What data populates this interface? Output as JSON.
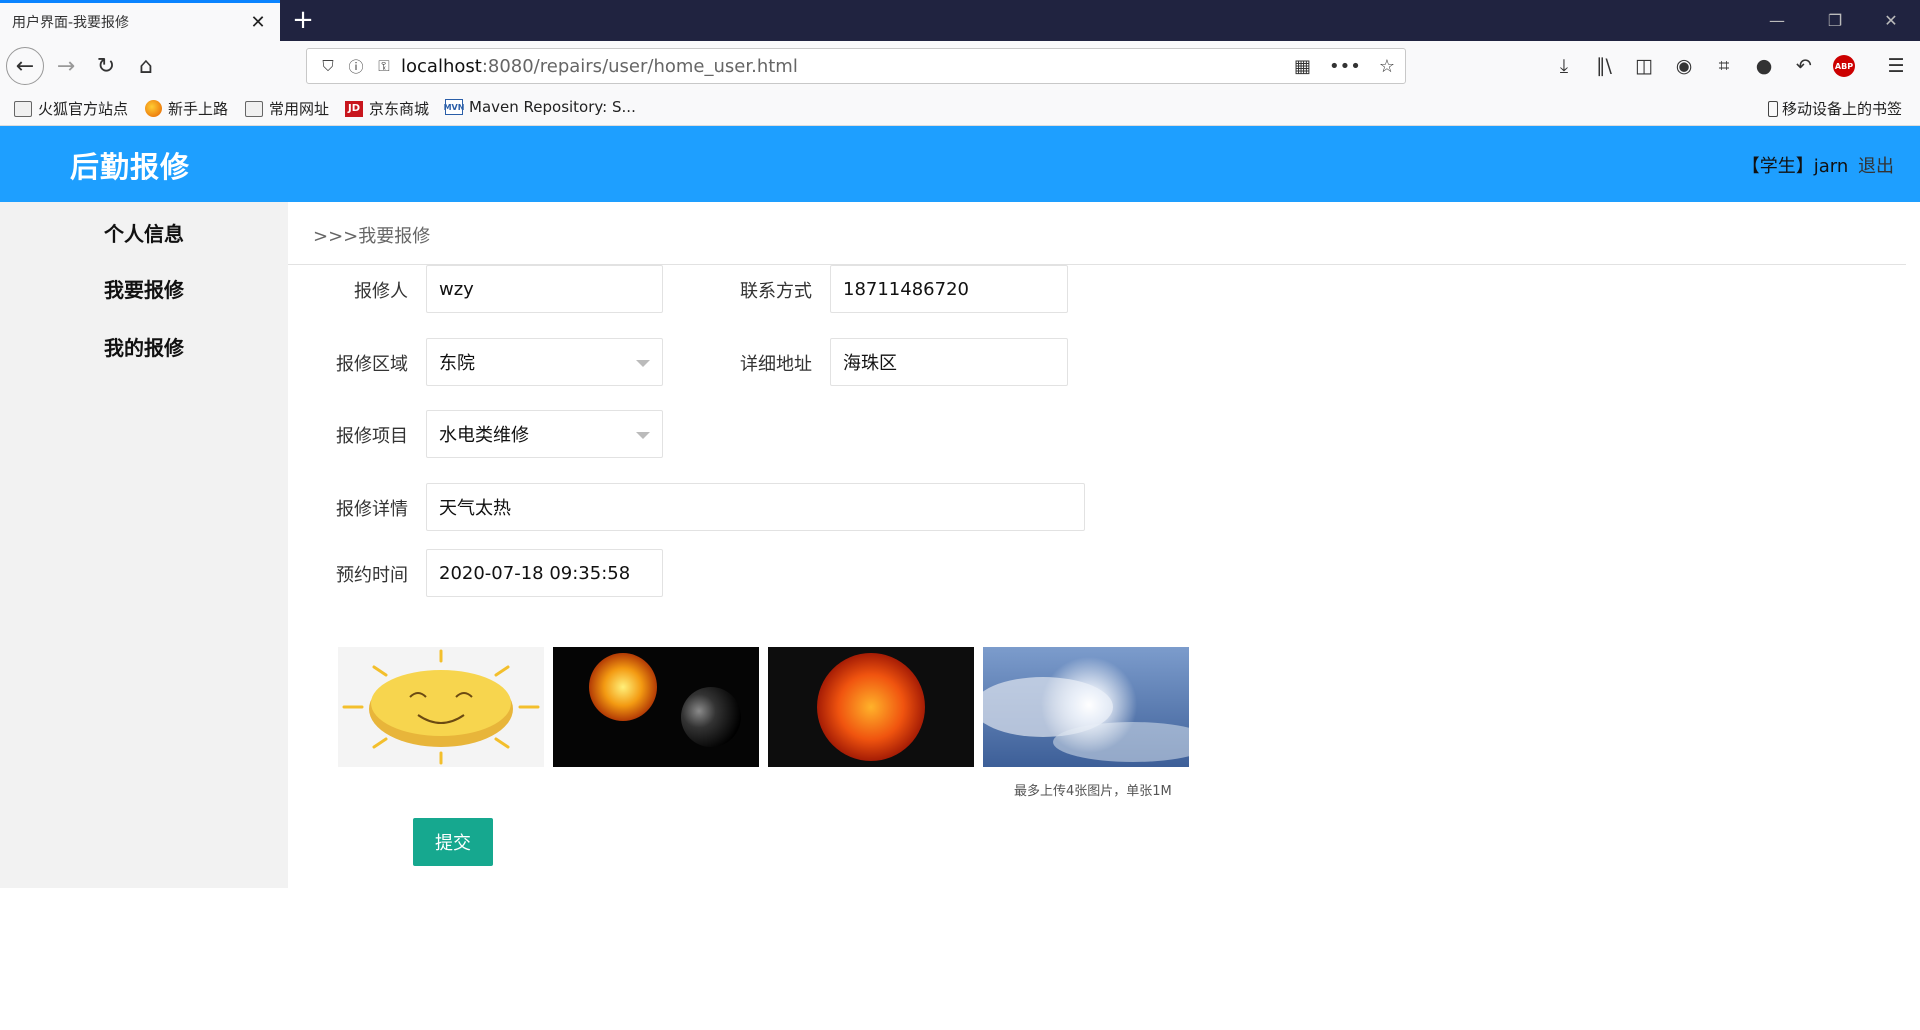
{
  "browser": {
    "tab_title": "用户界面-我要报修",
    "tab_close": "✕",
    "new_tab": "+",
    "url_host": "localhost",
    "url_rest": ":8080/repairs/user/home_user.html",
    "bookmarks": [
      {
        "label": "火狐官方站点",
        "icon": "folder-icon"
      },
      {
        "label": "新手上路",
        "icon": "firefox-icon"
      },
      {
        "label": "常用网址",
        "icon": "folder-icon"
      },
      {
        "label": "京东商城",
        "icon": "jd-icon"
      },
      {
        "label": "Maven Repository: S...",
        "icon": "maven-icon"
      }
    ],
    "jd_icon_text": "JD",
    "mvn_icon_text": "MVN",
    "mobile_bookmarks": "移动设备上的书签",
    "abp": "ABP"
  },
  "app": {
    "brand": "后勤报修",
    "user_role": "【学生】",
    "user_name": "jarn",
    "logout": "退出"
  },
  "sidebar": {
    "items": [
      {
        "label": "个人信息"
      },
      {
        "label": "我要报修"
      },
      {
        "label": "我的报修"
      }
    ]
  },
  "breadcrumb": ">>>我要报修",
  "form": {
    "reporter_label": "报修人",
    "reporter_value": "wzy",
    "contact_label": "联系方式",
    "contact_value": "18711486720",
    "area_label": "报修区域",
    "area_value": "东院",
    "address_label": "详细地址",
    "address_value": "海珠区",
    "item_label": "报修项目",
    "item_value": "水电类维修",
    "detail_label": "报修详情",
    "detail_value": "天气太热",
    "time_label": "预约时间",
    "time_value": "2020-07-18 09:35:58",
    "upload_hint": "最多上传4张图片，单张1M",
    "submit": "提交"
  },
  "colors": {
    "header": "#1e9fff",
    "submit": "#16a88f",
    "sidebar": "#f2f2f2"
  }
}
